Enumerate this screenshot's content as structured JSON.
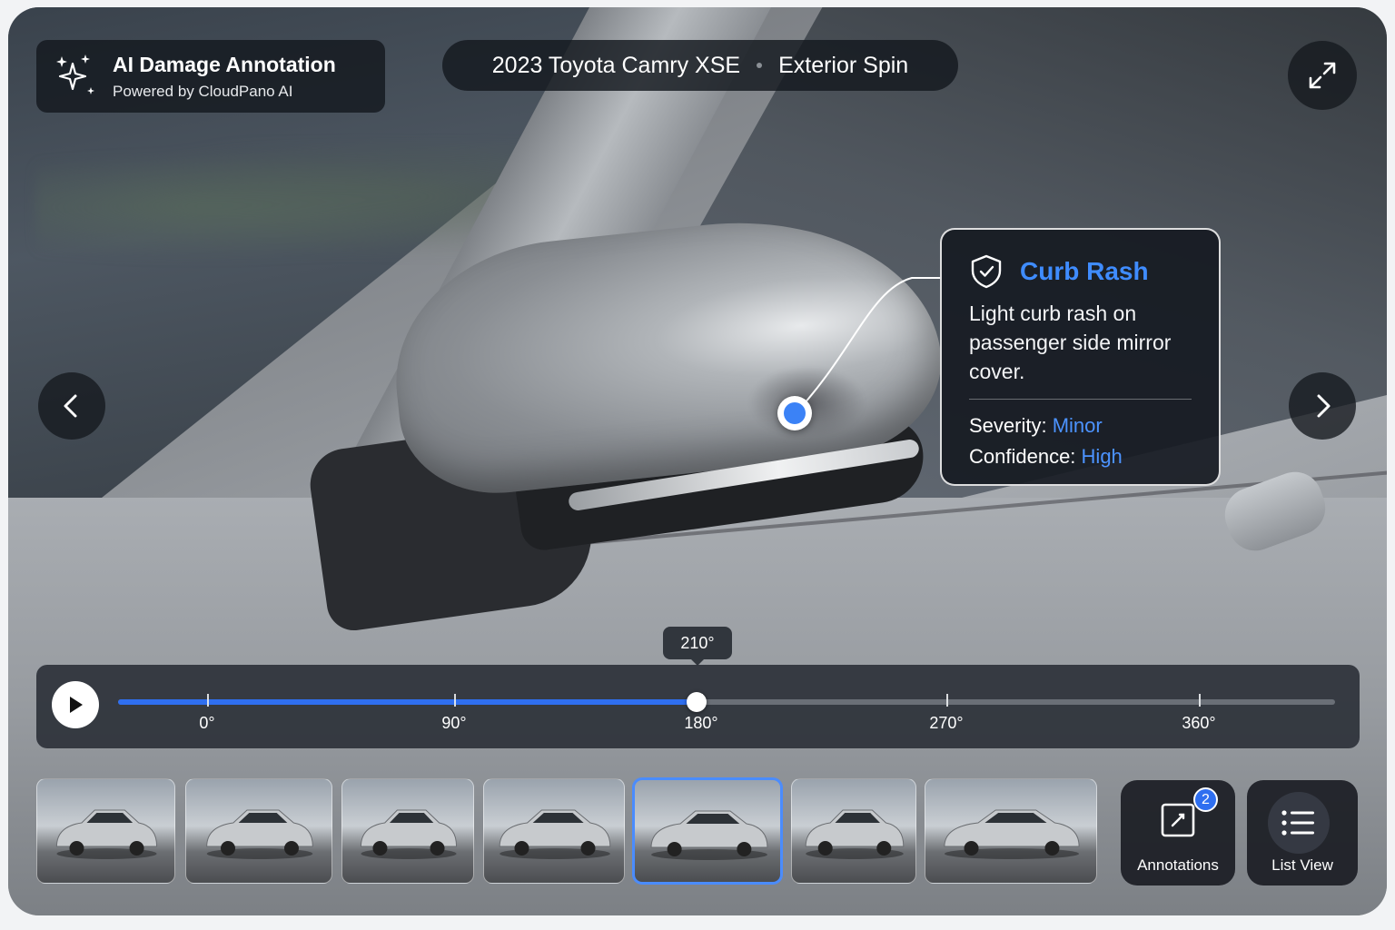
{
  "header": {
    "brand_title": "AI Damage Annotation",
    "brand_subtitle": "Powered by CloudPano AI",
    "vehicle": "2023 Toyota Camry XSE",
    "view_mode": "Exterior Spin"
  },
  "annotation": {
    "title": "Curb Rash",
    "description": "Light curb rash on passenger side mirror cover.",
    "severity_label": "Severity:",
    "severity_value": "Minor",
    "confidence_label": "Confidence:",
    "confidence_value": "High"
  },
  "spin": {
    "current_angle_label": "210°",
    "current_angle": 180,
    "max_angle": 360,
    "ticks": [
      {
        "label": "0°",
        "value": 0
      },
      {
        "label": "90°",
        "value": 90
      },
      {
        "label": "180°",
        "value": 180
      },
      {
        "label": "270°",
        "value": 270
      },
      {
        "label": "360°",
        "value": 360
      }
    ]
  },
  "thumbnails": [
    {
      "view": "front",
      "active": false
    },
    {
      "view": "front-three-quarter-left",
      "active": false
    },
    {
      "view": "front-three-quarter-right",
      "active": false
    },
    {
      "view": "side-left",
      "active": false
    },
    {
      "view": "side-right",
      "active": true
    },
    {
      "view": "rear-three-quarter",
      "active": false
    },
    {
      "view": "side-rear",
      "active": false
    }
  ],
  "actions": {
    "annotations_label": "Annotations",
    "annotations_count": "2",
    "list_view_label": "List View"
  },
  "icons": {
    "brand": "sparkles-icon",
    "expand": "expand-icon",
    "prev": "chevron-left-icon",
    "next": "chevron-right-icon",
    "annotation": "shield-check-icon",
    "play": "play-icon",
    "annotations": "edit-square-icon",
    "list": "list-icon"
  },
  "colors": {
    "accent": "#3f8cff",
    "panel": "#14181e"
  }
}
